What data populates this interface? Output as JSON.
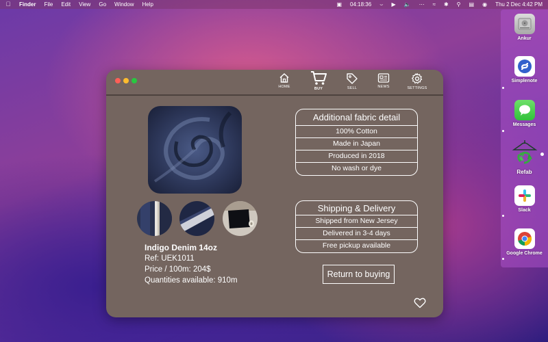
{
  "menubar": {
    "app": "Finder",
    "menus": [
      "File",
      "Edit",
      "View",
      "Go",
      "Window",
      "Help"
    ],
    "timer": "04:18:36",
    "datetime": "Thu 2 Dec  4:42 PM"
  },
  "dock": {
    "items": [
      {
        "label": "Ankur",
        "icon": "hard-drive-icon"
      },
      {
        "label": "Simplenote",
        "icon": "simplenote-icon"
      },
      {
        "label": "Messages",
        "icon": "messages-icon"
      },
      {
        "label": "Refab",
        "icon": "refab-icon"
      },
      {
        "label": "Slack",
        "icon": "slack-icon"
      },
      {
        "label": "Google Chrome",
        "icon": "chrome-icon"
      }
    ]
  },
  "nav": {
    "items": [
      {
        "label": "HOME",
        "icon": "home-icon"
      },
      {
        "label": "BUY",
        "icon": "cart-icon",
        "active": true
      },
      {
        "label": "SELL",
        "icon": "tag-icon"
      },
      {
        "label": "NEWS",
        "icon": "newspaper-icon"
      },
      {
        "label": "SETTINGS",
        "icon": "gear-icon"
      }
    ]
  },
  "product": {
    "title": "Indigo Denim 14oz",
    "ref": "Ref: UEK1011",
    "price": "Price / 100m:  204$",
    "quantity": "Quantities available: 910m"
  },
  "fabric_details": {
    "title": "Additional fabric detail",
    "rows": [
      "100% Cotton",
      "Made in Japan",
      "Produced in 2018",
      "No wash or dye"
    ]
  },
  "shipping": {
    "title": "Shipping & Delivery",
    "rows": [
      "Shipped from New Jersey",
      "Delivered in 3-4 days",
      "Free pickup available"
    ]
  },
  "return_button": "Return to buying",
  "colors": {
    "window_bg": "#74655f",
    "text": "#ffffff"
  }
}
